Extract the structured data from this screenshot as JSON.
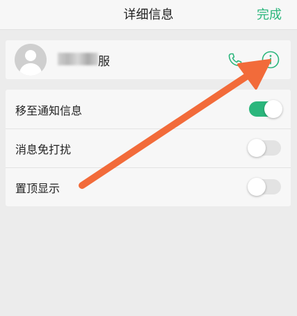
{
  "header": {
    "title": "详细信息",
    "done_label": "完成"
  },
  "contact": {
    "name_visible": "服",
    "name_redacted": true,
    "actions": [
      "phone-icon",
      "info-icon"
    ]
  },
  "settings": [
    {
      "label": "移至通知信息",
      "enabled": true
    },
    {
      "label": "消息免打扰",
      "enabled": false
    },
    {
      "label": "置顶显示",
      "enabled": false
    }
  ],
  "colors": {
    "accent": "#2bb67c",
    "annotation_arrow": "#f26b3a",
    "toggle_off": "#e3e3e3"
  }
}
